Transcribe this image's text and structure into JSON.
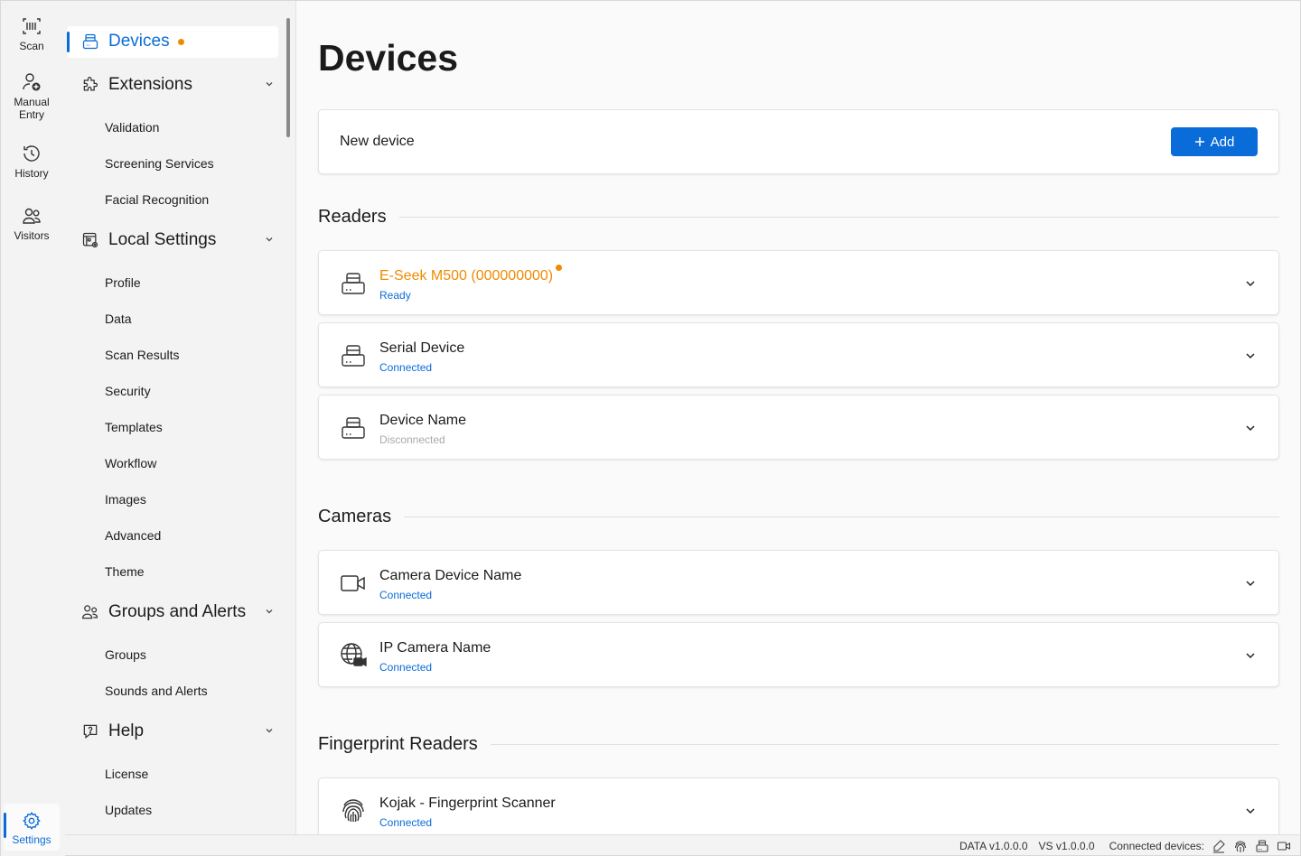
{
  "rail": {
    "scan": "Scan",
    "manual_entry_l1": "Manual",
    "manual_entry_l2": "Entry",
    "history": "History",
    "visitors": "Visitors",
    "settings": "Settings"
  },
  "nav": {
    "devices": "Devices",
    "extensions": {
      "label": "Extensions",
      "items": [
        "Validation",
        "Screening Services",
        "Facial Recognition"
      ]
    },
    "local_settings": {
      "label": "Local Settings",
      "items": [
        "Profile",
        "Data",
        "Scan Results",
        "Security",
        "Templates",
        "Workflow",
        "Images",
        "Advanced",
        "Theme"
      ]
    },
    "groups_alerts": {
      "label": "Groups and Alerts",
      "items": [
        "Groups",
        "Sounds and Alerts"
      ]
    },
    "help": {
      "label": "Help",
      "items": [
        "License",
        "Updates"
      ]
    }
  },
  "main": {
    "title": "Devices",
    "new_device": {
      "label": "New device",
      "add_label": "Add"
    },
    "readers": {
      "title": "Readers",
      "items": [
        {
          "name": "E-Seek M500 (000000000)",
          "status": "Ready"
        },
        {
          "name": "Serial Device",
          "status": "Connected"
        },
        {
          "name": "Device Name",
          "status": "Disconnected"
        }
      ]
    },
    "cameras": {
      "title": "Cameras",
      "items": [
        {
          "name": "Camera Device Name",
          "status": "Connected"
        },
        {
          "name": "IP Camera Name",
          "status": "Connected"
        }
      ]
    },
    "fingerprint": {
      "title": "Fingerprint Readers",
      "items": [
        {
          "name": "Kojak - Fingerprint Scanner",
          "status": "Connected"
        }
      ]
    }
  },
  "statusbar": {
    "data_version": "DATA  v1.0.0.0",
    "vs_version": "VS  v1.0.0.0",
    "connected_label": "Connected devices:"
  },
  "colors": {
    "accent": "#0a6cd8",
    "warning": "#f08b00",
    "muted": "#a9a9a9"
  }
}
